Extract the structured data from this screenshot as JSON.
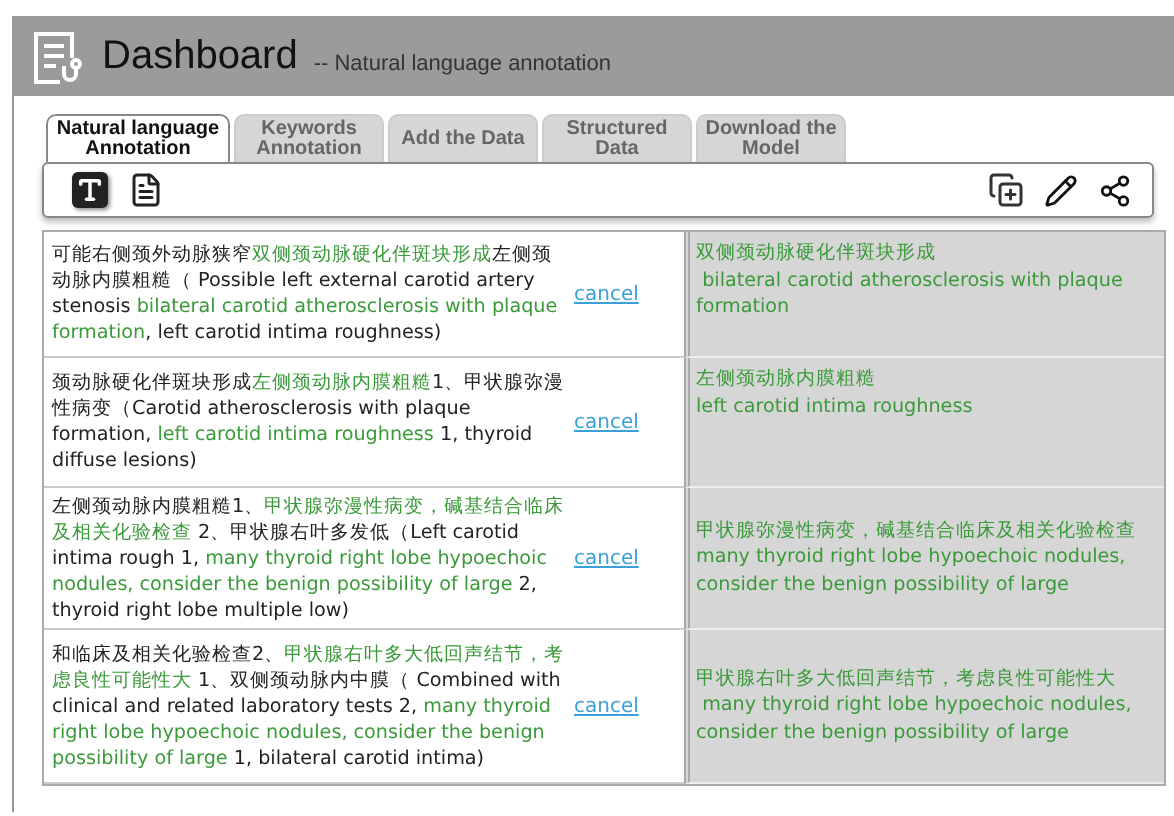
{
  "header": {
    "title": "Dashboard",
    "subtitle": "-- Natural language annotation"
  },
  "tabs": [
    {
      "label": "Natural language Annotation",
      "selected": true
    },
    {
      "label": "Keywords Annotation",
      "selected": false
    },
    {
      "label": "Add the Data",
      "selected": false
    },
    {
      "label": "Structured Data",
      "selected": false
    },
    {
      "label": "Download the Model",
      "selected": false
    }
  ],
  "toolbar": {
    "text_mode_selected": true
  },
  "rows": [
    {
      "source": [
        {
          "text": "可能右侧颈外动脉狭窄",
          "highlighted": false
        },
        {
          "text": "双侧颈动脉硬化伴斑块形成",
          "highlighted": true
        },
        {
          "text": "左侧颈动脉内膜粗糙（ Possible left external carotid artery stenosis ",
          "highlighted": false
        },
        {
          "text": "bilateral carotid atherosclerosis with plaque formation",
          "highlighted": true
        },
        {
          "text": ", left carotid intima roughness)",
          "highlighted": false
        }
      ],
      "action": "cancel",
      "annotation": [
        "双侧颈动脉硬化伴斑块形成",
        " bilateral carotid atherosclerosis with plaque formation"
      ]
    },
    {
      "source": [
        {
          "text": "颈动脉硬化伴斑块形成",
          "highlighted": false
        },
        {
          "text": "左侧颈动脉内膜粗糙",
          "highlighted": true
        },
        {
          "text": "1、甲状腺弥漫性病变（Carotid atherosclerosis with plaque formation, ",
          "highlighted": false
        },
        {
          "text": "left carotid intima roughness",
          "highlighted": true
        },
        {
          "text": " 1, thyroid diffuse lesions)",
          "highlighted": false
        }
      ],
      "action": "cancel",
      "annotation": [
        "左侧颈动脉内膜粗糙",
        "left carotid intima roughness"
      ]
    },
    {
      "source": [
        {
          "text": "左侧颈动脉内膜粗糙1、",
          "highlighted": false
        },
        {
          "text": "甲状腺弥漫性病变，碱基结合临床及相关化验检查",
          "highlighted": true
        },
        {
          "text": " 2、甲状腺右叶多发低（Left carotid intima rough 1, ",
          "highlighted": false
        },
        {
          "text": "many thyroid right lobe hypoechoic nodules, consider the benign possibility of large",
          "highlighted": true
        },
        {
          "text": " 2, thyroid right lobe multiple low)",
          "highlighted": false
        }
      ],
      "action": "cancel",
      "annotation": [
        "甲状腺弥漫性病变，碱基结合临床及相关化验检查",
        "many thyroid right lobe hypoechoic nodules, consider the benign possibility of large"
      ]
    },
    {
      "source": [
        {
          "text": "和临床及相关化验检查2、",
          "highlighted": false
        },
        {
          "text": "甲状腺右叶多大低回声结节，考虑良性可能性大",
          "highlighted": true
        },
        {
          "text": " 1、双侧颈动脉内中膜（ Combined with clinical and related laboratory tests 2, ",
          "highlighted": false
        },
        {
          "text": "many thyroid right lobe hypoechoic nodules, consider the benign possibility of large",
          "highlighted": true
        },
        {
          "text": " 1, bilateral carotid intima)",
          "highlighted": false
        }
      ],
      "action": "cancel",
      "annotation": [
        "甲状腺右叶多大低回声结节，考虑良性可能性大",
        " many thyroid right lobe hypoechoic nodules, consider the benign possibility of large"
      ]
    }
  ]
}
